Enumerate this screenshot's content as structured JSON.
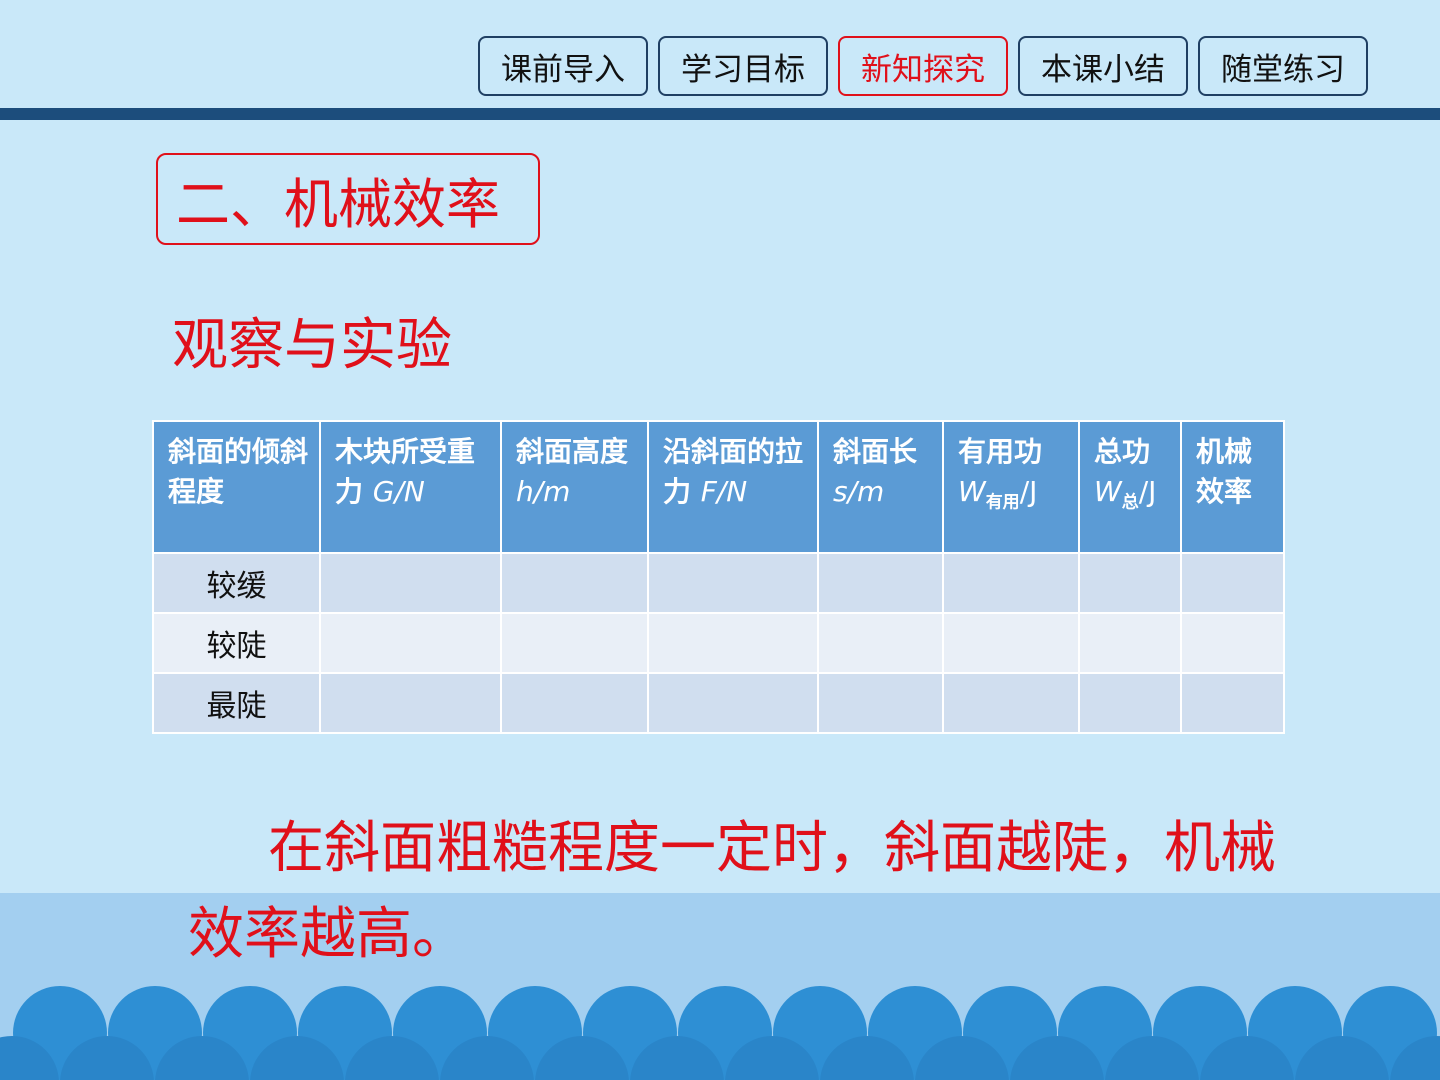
{
  "nav": {
    "items": [
      {
        "label": "课前导入",
        "active": false
      },
      {
        "label": "学习目标",
        "active": false
      },
      {
        "label": "新知探究",
        "active": true
      },
      {
        "label": "本课小结",
        "active": false
      },
      {
        "label": "随堂练习",
        "active": false
      }
    ]
  },
  "section": {
    "title": "二、机械效率"
  },
  "subtitle": "观察与实验",
  "table": {
    "headers": {
      "h0": "斜面的倾斜程度",
      "h1_text": "木块所受重力",
      "h1_unit": "G/N",
      "h2_text": "斜面高度",
      "h2_unit": "h/m",
      "h3_text": "沿斜面的拉力",
      "h3_unit": "F/N",
      "h4_text": "斜面长",
      "h4_unit": "s/m",
      "h5_text": "有用功",
      "h5_sym": "W",
      "h5_sub": "有用",
      "h5_unit": "/J",
      "h6_text": "总功",
      "h6_sym": "W",
      "h6_sub": "总",
      "h6_unit": "/J",
      "h7": "机械效率"
    },
    "rows": [
      {
        "label": "较缓"
      },
      {
        "label": "较陡"
      },
      {
        "label": "最陡"
      }
    ]
  },
  "conclusion": "在斜面粗糙程度一定时，斜面越陡，机械效率越高。",
  "colors": {
    "accent_red": "#e0101a",
    "nav_border": "#1f3f63",
    "divider": "#1c4d7c",
    "header_blue": "#5b9bd5",
    "bg": "#c9e8f9"
  }
}
